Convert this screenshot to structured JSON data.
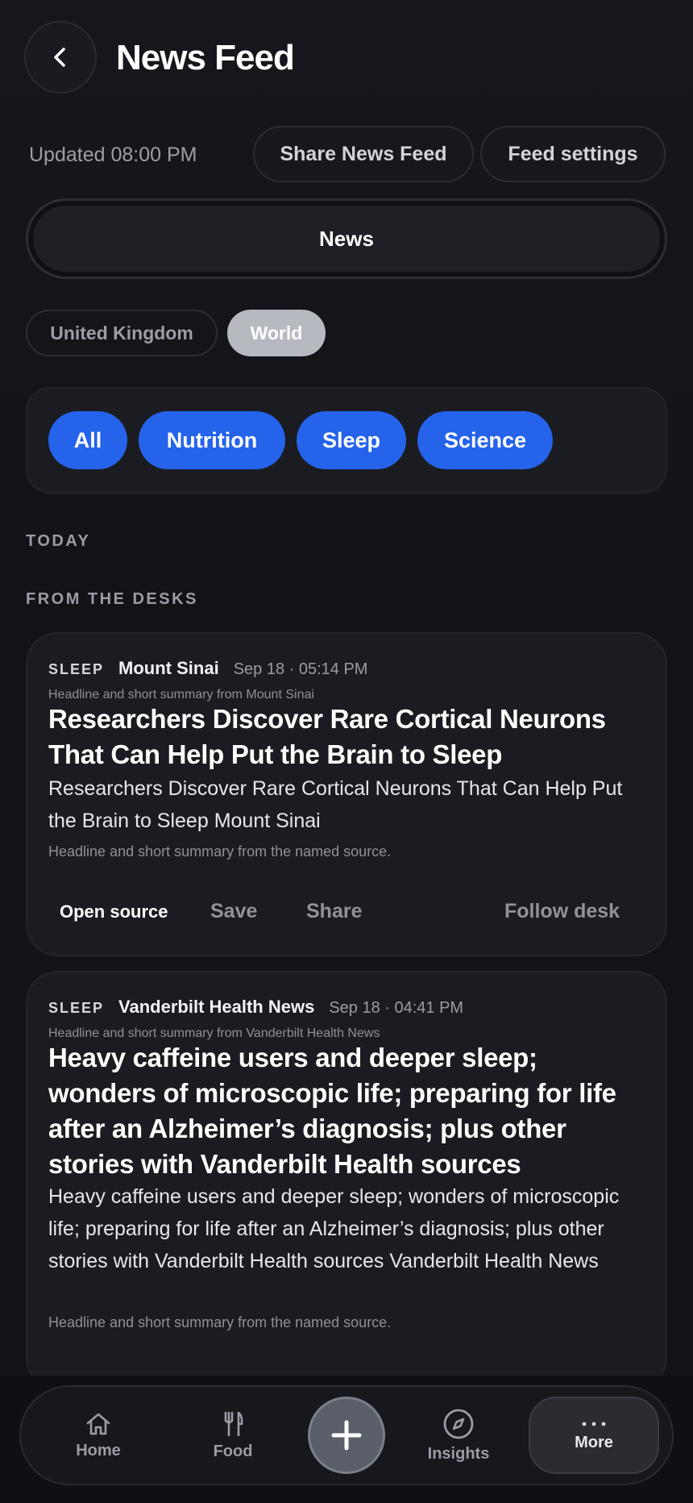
{
  "header": {
    "title": "News Feed",
    "updated": "Updated 08:00 PM",
    "share_label": "Share News Feed",
    "settings_label": "Feed settings"
  },
  "segment": {
    "selected": "News"
  },
  "regions": [
    {
      "label": "United Kingdom",
      "selected": false
    },
    {
      "label": "World",
      "selected": true
    }
  ],
  "categories": [
    {
      "label": "All"
    },
    {
      "label": "Nutrition"
    },
    {
      "label": "Sleep"
    },
    {
      "label": "Science"
    }
  ],
  "sections": {
    "today": "TODAY",
    "desks": "FROM THE DESKS"
  },
  "articles": [
    {
      "category": "SLEEP",
      "source": "Mount Sinai",
      "time": "Sep 18 · 05:14 PM",
      "subline": "Headline and short summary from Mount Sinai",
      "headline": "Researchers Discover Rare Cortical Neurons That Can Help Put the Brain to Sleep",
      "summary": "Researchers Discover Rare Cortical Neurons That Can Help Put the Brain to Sleep Mount Sinai",
      "note": "Headline and short summary from the named source.",
      "actions": {
        "open": "Open source",
        "save": "Save",
        "share": "Share",
        "follow": "Follow desk"
      }
    },
    {
      "category": "SLEEP",
      "source": "Vanderbilt Health News",
      "time": "Sep 18 · 04:41 PM",
      "subline": "Headline and short summary from Vanderbilt Health News",
      "headline": "Heavy caffeine users and deeper sleep; wonders of microscopic life; preparing for life after an Alzheimer’s diagnosis; plus other stories with Vanderbilt Health sources",
      "summary": "Heavy caffeine users and deeper sleep; wonders of microscopic life; preparing for life after an Alzheimer’s diagnosis; plus other stories with Vanderbilt Health sources Vanderbilt Health News",
      "note": "Headline and short summary from the named source."
    }
  ],
  "nav": {
    "home": "Home",
    "food": "Food",
    "insights": "Insights",
    "more": "More",
    "icons": {
      "home": "home-icon",
      "food": "fork-knife-icon",
      "add": "plus-icon",
      "insights": "compass-icon",
      "more": "ellipsis-icon"
    }
  },
  "colors": {
    "background": "#141519",
    "accent": "#2563eb",
    "card": "#1b1c21",
    "muted_text": "#9a9da5"
  }
}
